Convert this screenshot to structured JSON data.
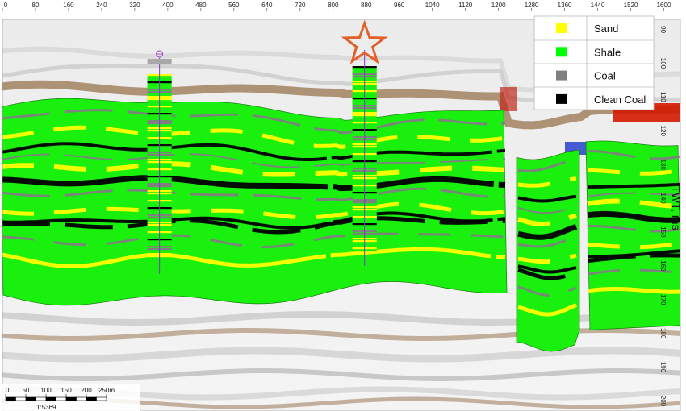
{
  "chart_data": {
    "type": "heatmap",
    "title": "",
    "xlabel": "",
    "ylabel": "TWT, ms",
    "x_ticks": [
      0,
      80,
      160,
      240,
      320,
      400,
      480,
      560,
      640,
      720,
      800,
      880,
      960,
      1040,
      1120,
      1200,
      1280,
      1360,
      1440,
      1520,
      1600
    ],
    "y_ticks": [
      90,
      100,
      110,
      120,
      130,
      140,
      150,
      160,
      170,
      180,
      190,
      200
    ],
    "xlim": [
      0,
      1640
    ],
    "ylim": [
      87,
      203
    ],
    "legend_position": "top-right",
    "legend": [
      {
        "label": "Sand",
        "color": "#ffff00"
      },
      {
        "label": "Shale",
        "color": "#00ff00"
      },
      {
        "label": "Coal",
        "color": "#7f7f7f"
      },
      {
        "label": "Clean Coal",
        "color": "#000000"
      }
    ],
    "wells": [
      {
        "x": 380,
        "marker": "well-circle-icon"
      },
      {
        "x": 876,
        "marker": "star-icon"
      }
    ],
    "scale_bar": {
      "ticks": [
        "0",
        "50",
        "100",
        "150",
        "200",
        "250m"
      ],
      "ratio": "1:5369"
    }
  }
}
